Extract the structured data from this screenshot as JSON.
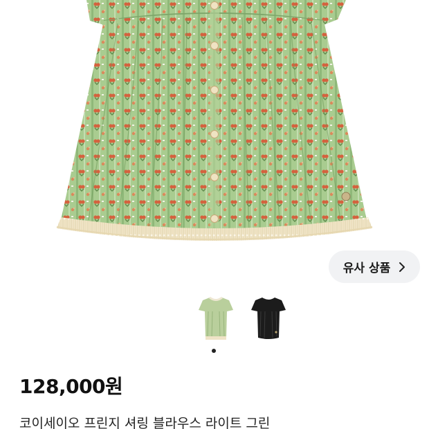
{
  "product": {
    "image_alt": "green floral short-sleeve dress with fringe hem",
    "pattern_colors": {
      "base": "#a9cc90",
      "stripe": "#8fb879",
      "flower": "#d4623e",
      "leaf": "#5f8a4c",
      "fringe": "#efe3c6"
    },
    "variant_colors": [
      "#b9cf9c",
      "#1c1c1c"
    ],
    "carousel": {
      "total_pages": 1,
      "active_index": 0
    },
    "price": "128,000원",
    "title": "코이세이오 프린지 셔링 블라우스 라이트 그린"
  },
  "actions": {
    "similar_label": "유사 상품",
    "similar_icon": "chevron-right-icon"
  }
}
